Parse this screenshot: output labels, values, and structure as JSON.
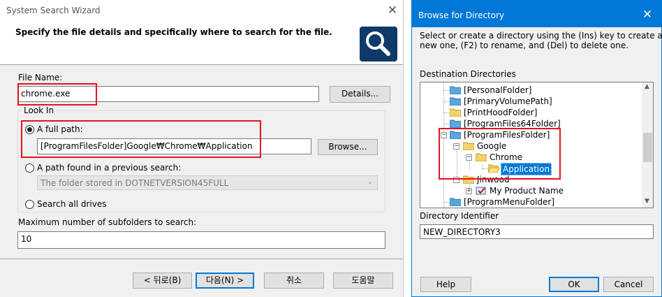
{
  "wizard": {
    "title": "System Search Wizard",
    "header": "Specify the file details and specifically where to search for the file.",
    "file_name_label": "File Name:",
    "file_name_value": "chrome.exe",
    "details_button": "Details...",
    "look_in_label": "Look In",
    "opt_full_path": "A full path:",
    "full_path_value": "[ProgramFilesFolder]Google₩Chrome₩Application",
    "browse_button": "Browse...",
    "opt_previous": "A path found in a previous search:",
    "previous_value": "The folder stored in DOTNETVERSION45FULL",
    "opt_all_drives": "Search all drives",
    "max_label": "Maximum number of subfolders to search:",
    "max_value": "10",
    "back_button": "< 뒤로(B)",
    "next_button": "다음(N) >",
    "cancel_button": "취소",
    "help_button": "도움말"
  },
  "browse": {
    "title": "Browse for Directory",
    "instructions_line1": "Select or create a directory using the (Ins) key to create a",
    "instructions_line2": "new one, (F2) to rename, and (Del) to delete one.",
    "dest_label": "Destination Directories",
    "tree": [
      "[PersonalFolder]",
      "[PrimaryVolumePath]",
      "[PrintHoodFolder]",
      "[ProgramFiles64Folder]",
      "[ProgramFilesFolder]",
      "Google",
      "Chrome",
      "Application",
      "Jinwood",
      "My Product Name",
      "[ProgramMenuFolder]"
    ],
    "identifier_label": "Directory Identifier",
    "identifier_value": "NEW_DIRECTORY3",
    "help_button": "Help",
    "ok_button": "OK",
    "cancel_button": "Cancel",
    "close_glyph": "✕",
    "expand_glyph": "+",
    "collapse_glyph": "−"
  },
  "colors": {
    "browse_titlebar": "#0078d7",
    "highlight": "#e8101f",
    "selection": "#0078d7"
  }
}
